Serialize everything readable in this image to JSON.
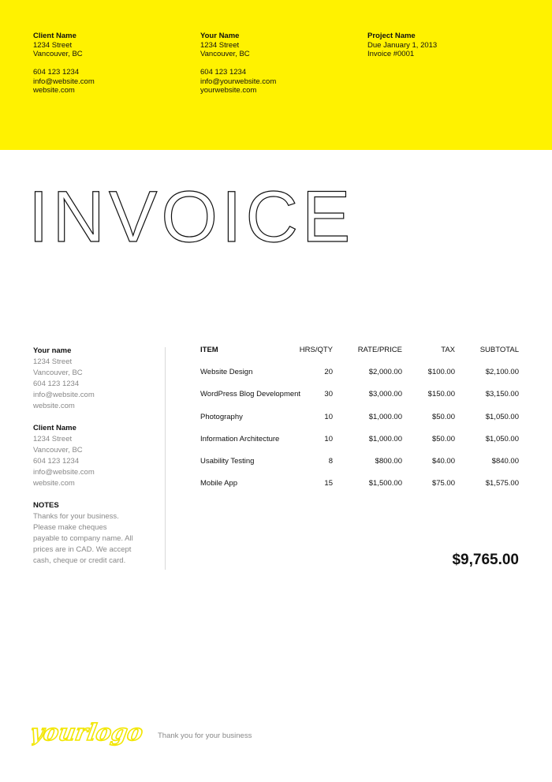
{
  "header": {
    "client": {
      "title": "Client Name",
      "street": "1234 Street",
      "city": "Vancouver, BC",
      "phone": "604 123 1234",
      "email": "info@website.com",
      "web": "website.com"
    },
    "you": {
      "title": "Your Name",
      "street": "1234 Street",
      "city": "Vancouver, BC",
      "phone": "604 123 1234",
      "email": "info@yourwebsite.com",
      "web": "yourwebsite.com"
    },
    "project": {
      "title": "Project Name",
      "due": "Due January 1, 2013",
      "invoice_no": "Invoice #0001"
    }
  },
  "title": "INVOICE",
  "sidebar": {
    "you": {
      "title": "Your name",
      "street": "1234 Street",
      "city": "Vancouver, BC",
      "phone": "604 123 1234",
      "email": "info@website.com",
      "web": "website.com"
    },
    "client": {
      "title": "Client Name",
      "street": "1234 Street",
      "city": "Vancouver, BC",
      "phone": "604 123 1234",
      "email": "info@website.com",
      "web": "website.com"
    },
    "notes": {
      "title": "NOTES",
      "lines": [
        "Thanks for your business.",
        "Please make cheques",
        "payable to company name. All",
        "prices are in CAD. We accept",
        "cash, cheque or credit card."
      ]
    }
  },
  "table": {
    "headers": {
      "item": "ITEM",
      "qty": "HRS/QTY",
      "rate": "RATE/PRICE",
      "tax": "TAX",
      "subtotal": "SUBTOTAL"
    },
    "rows": [
      {
        "item": "Website Design",
        "qty": "20",
        "rate": "$2,000.00",
        "tax": "$100.00",
        "subtotal": "$2,100.00"
      },
      {
        "item": "WordPress Blog Development",
        "qty": "30",
        "rate": "$3,000.00",
        "tax": "$150.00",
        "subtotal": "$3,150.00"
      },
      {
        "item": "Photography",
        "qty": "10",
        "rate": "$1,000.00",
        "tax": "$50.00",
        "subtotal": "$1,050.00"
      },
      {
        "item": "Information Architecture",
        "qty": "10",
        "rate": "$1,000.00",
        "tax": "$50.00",
        "subtotal": "$1,050.00"
      },
      {
        "item": "Usability Testing",
        "qty": "8",
        "rate": "$800.00",
        "tax": "$40.00",
        "subtotal": "$840.00"
      },
      {
        "item": "Mobile App",
        "qty": "15",
        "rate": "$1,500.00",
        "tax": "$75.00",
        "subtotal": "$1,575.00"
      }
    ]
  },
  "total": "$9,765.00",
  "footer": {
    "logo_text": "yourlogo",
    "thanks": "Thank you for your business"
  },
  "colors": {
    "accent": "#fff200",
    "text": "#111111",
    "muted": "#888888"
  }
}
